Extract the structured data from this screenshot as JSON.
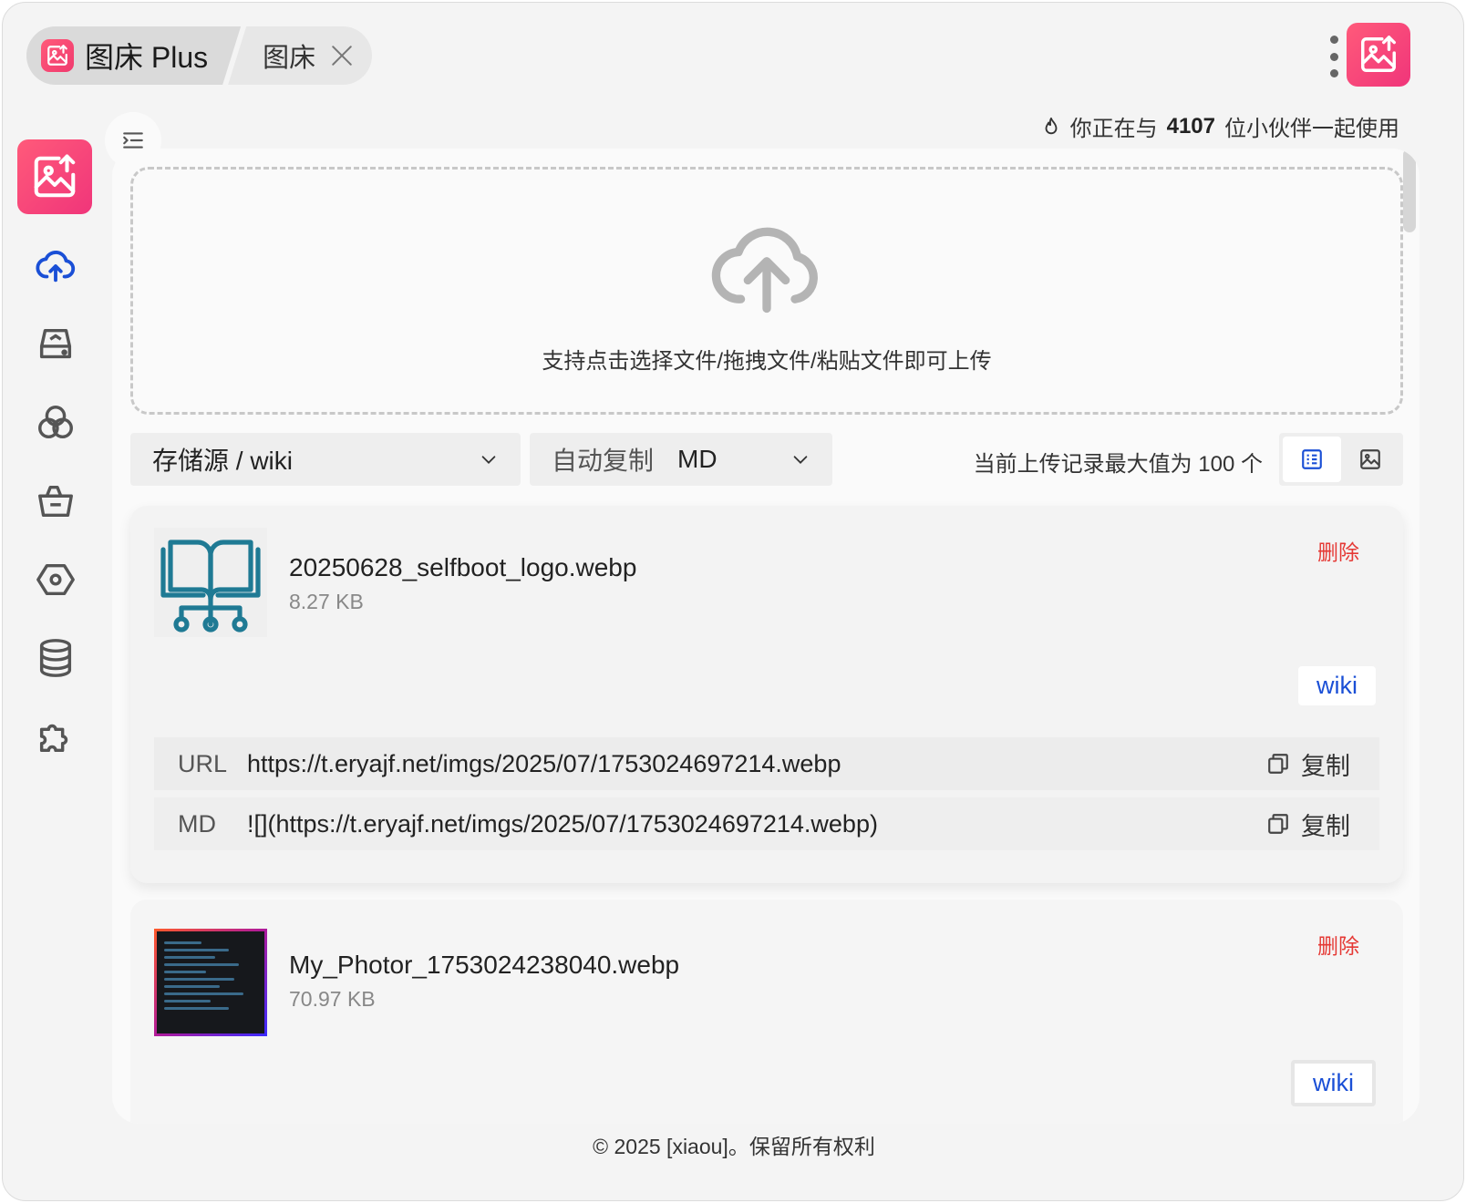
{
  "tabs": {
    "active_label": "图床 Plus",
    "second_label": "图床"
  },
  "header": {
    "user_count_prefix": "你正在与",
    "user_count": "4107",
    "user_count_suffix": "位小伙伴一起使用"
  },
  "sidebar": {
    "items": [
      {
        "name": "upload",
        "icon": "cloud-upload-icon"
      },
      {
        "name": "storage",
        "icon": "drive-icon"
      },
      {
        "name": "circles",
        "icon": "circles-icon"
      },
      {
        "name": "basket",
        "icon": "basket-icon"
      },
      {
        "name": "settings",
        "icon": "hexagon-icon"
      },
      {
        "name": "database",
        "icon": "database-icon"
      },
      {
        "name": "plugins",
        "icon": "puzzle-icon"
      }
    ]
  },
  "upload": {
    "hint": "支持点击选择文件/拖拽文件/粘贴文件即可上传"
  },
  "controls": {
    "storage_value": "存储源 / wiki",
    "copy_label": "自动复制",
    "copy_value": "MD",
    "limit_text": "当前上传记录最大值为 100 个"
  },
  "files": [
    {
      "name": "20250628_selfboot_logo.webp",
      "size": "8.27 KB",
      "delete_label": "删除",
      "tag": "wiki",
      "url_key": "URL",
      "url": "https://t.eryajf.net/imgs/2025/07/1753024697214.webp",
      "md_key": "MD",
      "md": "![](https://t.eryajf.net/imgs/2025/07/1753024697214.webp)",
      "copy_label": "复制"
    },
    {
      "name": "My_Photor_1753024238040.webp",
      "size": "70.97 KB",
      "delete_label": "删除",
      "tag": "wiki"
    }
  ],
  "footer": {
    "text": "© 2025 [xiaou]。保留所有权利"
  },
  "colors": {
    "brand": "#f0357a",
    "accent_blue": "#1a4fd6",
    "danger": "#e53935",
    "thumb_teal": "#1f7a94"
  }
}
